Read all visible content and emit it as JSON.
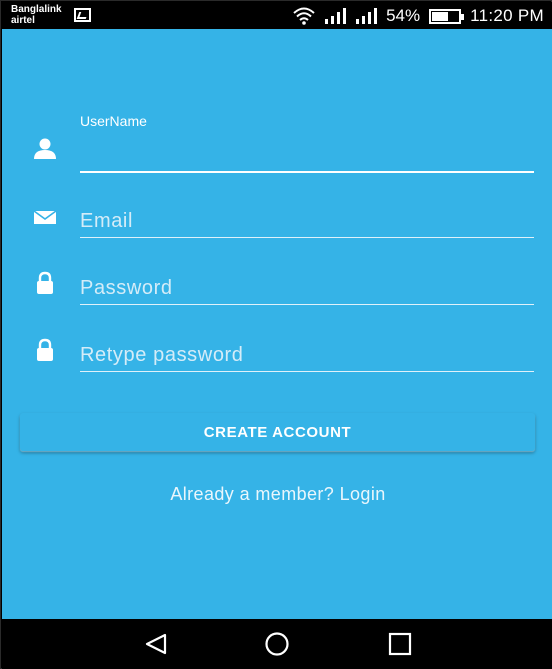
{
  "status_bar": {
    "carrier_1": "Banglalink",
    "carrier_2": "airtel",
    "battery_percent": "54%",
    "time": "11:20 PM",
    "icons": [
      "image-notification-icon",
      "wifi-icon",
      "signal-icon",
      "signal-icon",
      "battery-icon"
    ]
  },
  "form": {
    "username": {
      "label": "UserName",
      "value": "",
      "icon": "person-icon"
    },
    "email": {
      "placeholder": "Email",
      "icon": "envelope-icon"
    },
    "password": {
      "placeholder": "Password",
      "icon": "lock-icon"
    },
    "retype_password": {
      "placeholder": "Retype password",
      "icon": "lock-icon"
    },
    "create_button_label": "CREATE ACCOUNT",
    "login_link": "Already a member? Login"
  },
  "nav_bar": {
    "icons": [
      "back-icon",
      "home-icon",
      "recents-icon"
    ]
  },
  "colors": {
    "background": "#35b3e7",
    "text": "#ffffff",
    "bars": "#000000"
  }
}
